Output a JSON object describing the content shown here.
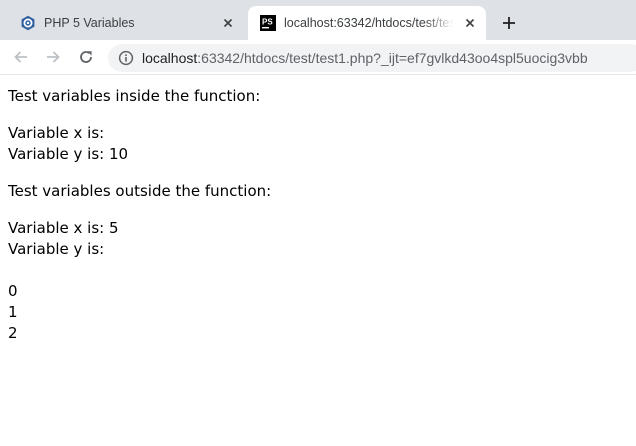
{
  "tabs": [
    {
      "title": "PHP 5 Variables",
      "close": "×",
      "active": false,
      "favicon": "php-tutorial-icon"
    },
    {
      "title": "localhost:63342/htdocs/test/test1.php?_ijt=ef7gvlkd43oo4spl5uocig3vbb",
      "close": "×",
      "active": true,
      "favicon": "phpstorm-icon",
      "favicon_text": "PS"
    }
  ],
  "new_tab": "+",
  "toolbar": {
    "url_host": "localhost",
    "url_rest": ":63342/htdocs/test/test1.php?_ijt=ef7gvlkd43oo4spl5uocig3vbb"
  },
  "content": {
    "heading_inside": "Test variables inside the function:",
    "inside_x": "Variable x is:",
    "inside_y": "Variable y is: 10",
    "heading_outside": "Test variables outside the function:",
    "outside_x": "Variable x is: 5",
    "outside_y": "Variable y is:",
    "numbers": [
      "0",
      "1",
      "2"
    ]
  },
  "colors": {
    "tabstrip": "#dee1e6",
    "omnibox": "#f1f3f4",
    "php_icon": "#2d5fa1",
    "phpstorm_icon": "#000000"
  }
}
